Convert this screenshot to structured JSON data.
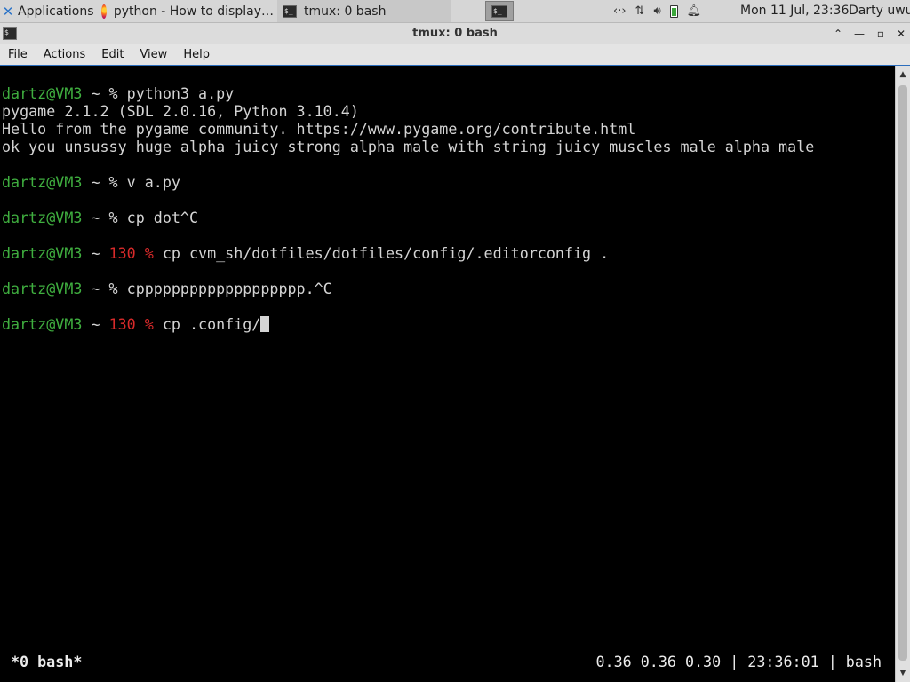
{
  "panel": {
    "applications_label": "Applications",
    "tasks": [
      {
        "label": "python - How to display…",
        "icon": "firefox-icon"
      },
      {
        "label": "tmux: 0 bash",
        "icon": "terminal-icon"
      }
    ],
    "tray_icons": [
      "network-icon",
      "transfer-icon",
      "volume-icon",
      "battery-icon",
      "notifications-icon"
    ],
    "clock": "Mon 11 Jul, 23:36",
    "user": "Darty uwu"
  },
  "window": {
    "title": "tmux: 0 bash",
    "buttons": [
      "maximize-restore",
      "minimize",
      "maximize",
      "close"
    ]
  },
  "menubar": {
    "items": [
      "File",
      "Actions",
      "Edit",
      "View",
      "Help"
    ]
  },
  "terminal": {
    "prompt_user": "dartz@VM3",
    "lines": {
      "l1_cmd": " ~ % python3 a.py",
      "l2": "pygame 2.1.2 (SDL 2.0.16, Python 3.10.4)",
      "l3": "Hello from the pygame community. https://www.pygame.org/contribute.html",
      "l4": "ok you unsussy huge alpha juicy strong alpha male with string juicy muscles male alpha male",
      "l5_cmd": " ~ % v a.py",
      "l6_cmd": " ~ % cp dot^C",
      "l7_mid": " ~ ",
      "l7_code": "130 %",
      "l7_cmd": " cp cvm_sh/dotfiles/dotfiles/config/.editorconfig .",
      "l8_cmd": " ~ % cppppppppppppppppppp.^C",
      "l9_mid": " ~ ",
      "l9_code": "130 %",
      "l9_cmd": " cp .config/"
    },
    "status_left": "*0 bash*",
    "status_right": "0.36 0.36 0.30 | 23:36:01 | bash"
  },
  "colors": {
    "prompt_green": "#3fae3f",
    "error_red": "#d82a2a",
    "terminal_bg": "#000000"
  }
}
